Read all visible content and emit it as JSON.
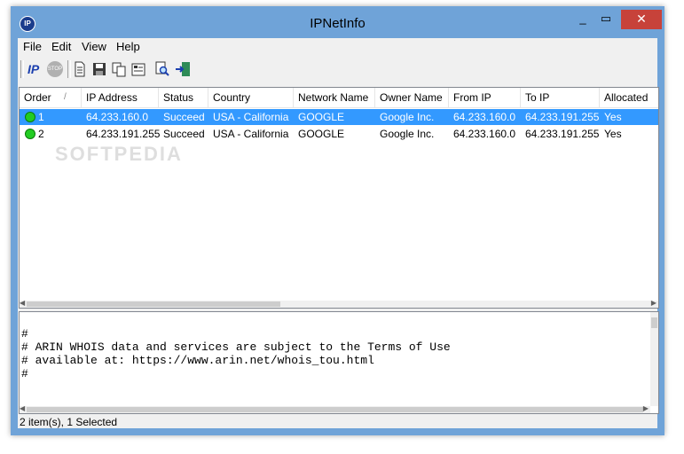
{
  "window": {
    "title": "IPNetInfo",
    "app_icon": "IP",
    "close_icon": "✕",
    "max_icon": "▭",
    "min_icon": "_"
  },
  "menu": [
    "File",
    "Edit",
    "View",
    "Help"
  ],
  "toolbar": {
    "ip_label": "IP",
    "stop_label": "STOP",
    "icons": [
      "ip-icon",
      "stop-icon",
      "new-document-icon",
      "save-icon",
      "copy-icon",
      "properties-icon",
      "find-icon",
      "exit-icon"
    ]
  },
  "list": {
    "columns": [
      "Order",
      "IP Address",
      "Status",
      "Country",
      "Network Name",
      "Owner Name",
      "From IP",
      "To IP",
      "Allocated"
    ],
    "sort_indicator": "/",
    "rows": [
      {
        "order": "1",
        "ip": "64.233.160.0",
        "status": "Succeed",
        "country": "USA - California",
        "network": "GOOGLE",
        "owner": "Google Inc.",
        "from_ip": "64.233.160.0",
        "to_ip": "64.233.191.255",
        "allocated": "Yes",
        "selected": true
      },
      {
        "order": "2",
        "ip": "64.233.191.255",
        "status": "Succeed",
        "country": "USA - California",
        "network": "GOOGLE",
        "owner": "Google Inc.",
        "from_ip": "64.233.160.0",
        "to_ip": "64.233.191.255",
        "allocated": "Yes",
        "selected": false
      }
    ]
  },
  "whois_lines": [
    "#",
    "# ARIN WHOIS data and services are subject to the Terms of Use",
    "# available at: https://www.arin.net/whois_tou.html",
    "#"
  ],
  "status": "2 item(s), 1 Selected",
  "watermark": "SOFTPEDIA",
  "colors": {
    "selection": "#3399ff",
    "close_button": "#c7423a",
    "frame": "#6fa3d8",
    "status_ok": "#22cc22"
  }
}
